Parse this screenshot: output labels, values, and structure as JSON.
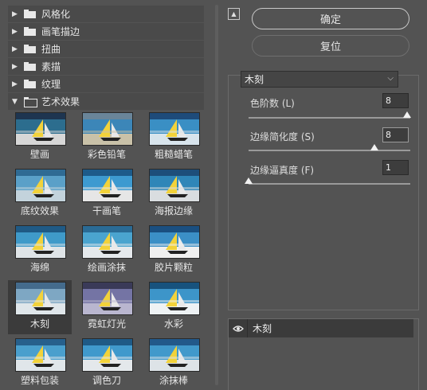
{
  "categories": [
    {
      "label": "风格化",
      "expanded": false
    },
    {
      "label": "画笔描边",
      "expanded": false
    },
    {
      "label": "扭曲",
      "expanded": false
    },
    {
      "label": "素描",
      "expanded": false
    },
    {
      "label": "纹理",
      "expanded": false
    },
    {
      "label": "艺术效果",
      "expanded": true
    }
  ],
  "thumbnails": [
    {
      "label": "壁画"
    },
    {
      "label": "彩色铅笔"
    },
    {
      "label": "粗糙蜡笔"
    },
    {
      "label": "底纹效果"
    },
    {
      "label": "干画笔"
    },
    {
      "label": "海报边缘"
    },
    {
      "label": "海绵"
    },
    {
      "label": "绘画涂抹"
    },
    {
      "label": "胶片颗粒"
    },
    {
      "label": "木刻",
      "selected": true
    },
    {
      "label": "霓虹灯光"
    },
    {
      "label": "水彩"
    },
    {
      "label": "塑料包装"
    },
    {
      "label": "调色刀"
    },
    {
      "label": "涂抹棒"
    }
  ],
  "buttons": {
    "ok": "确定",
    "reset": "复位"
  },
  "filter_select": {
    "value": "木刻"
  },
  "params": [
    {
      "label": "色阶数 (L)",
      "value": "8",
      "level": 0.98
    },
    {
      "label": "边缘简化度 (S)",
      "value": "8",
      "level": 0.78
    },
    {
      "label": "边缘逼真度 (F)",
      "value": "1",
      "level": 0.0
    }
  ],
  "layers": [
    {
      "name": "木刻"
    }
  ],
  "colors": {
    "panel_bg": "#535353",
    "selected_bg": "#3b3b3b",
    "text": "#e6e6e6"
  },
  "icons": {
    "collapse": "collapse-panel-icon",
    "eye": "eye-icon",
    "folder": "folder-icon"
  }
}
